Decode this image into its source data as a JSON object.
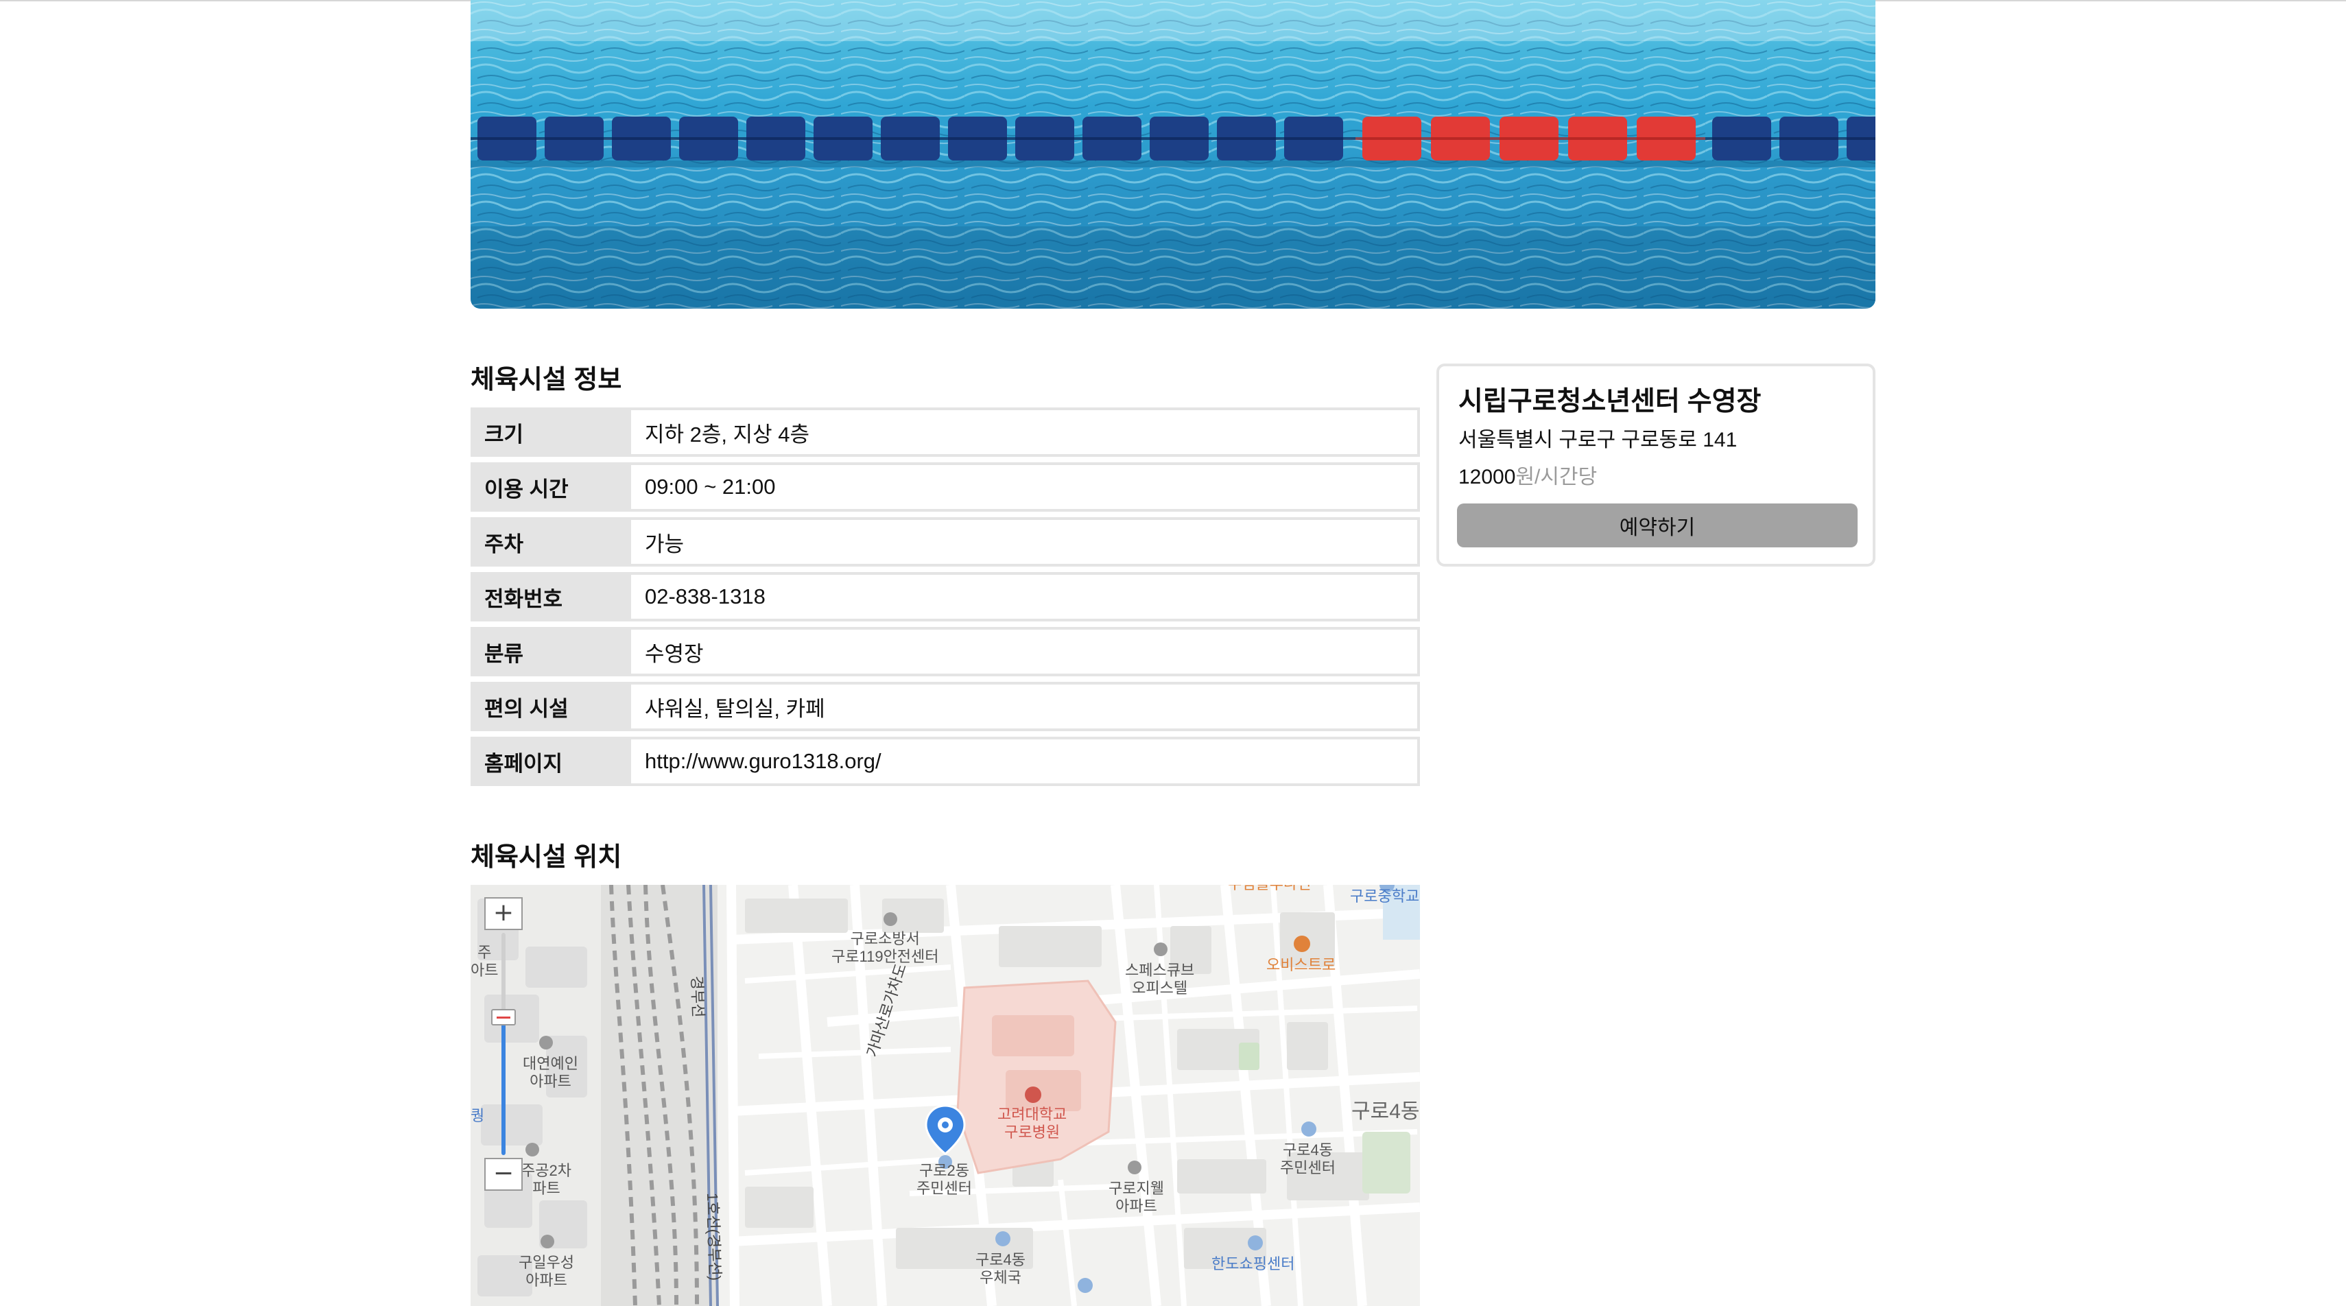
{
  "info_section": {
    "title": "체육시설 정보",
    "rows": [
      {
        "key": "크기",
        "value": "지하 2층, 지상 4층"
      },
      {
        "key": "이용 시간",
        "value": "09:00 ~ 21:00"
      },
      {
        "key": "주차",
        "value": "가능"
      },
      {
        "key": "전화번호",
        "value": "02-838-1318"
      },
      {
        "key": "분류",
        "value": "수영장"
      },
      {
        "key": "편의 시설",
        "value": "샤워실, 탈의실, 카페"
      },
      {
        "key": "홈페이지",
        "value": "http://www.guro1318.org/"
      }
    ]
  },
  "location_section": {
    "title": "체육시설 위치"
  },
  "booking_card": {
    "name": "시립구로청소년센터 수영장",
    "address": "서울특별시 구로구 구로동로 141",
    "price": "12000",
    "price_unit": "원/시간당",
    "reserve_label": "예약하기"
  },
  "map": {
    "zoom_in_label": "+",
    "zoom_out_label": "−",
    "zoom_level_fraction": 0.62,
    "labels": {
      "fire_station": "구로소방서\n구로119안전센터",
      "spacecube": "스페스큐브\n오피스텔",
      "obis": "오비스트로",
      "guro_middle": "구로중학교",
      "top_cut": "우림블루나인",
      "daeyeon": "대연예인\n아파트",
      "jugong": "주공2차\n파트",
      "guil": "구일우성\n아파트",
      "hospital": "고려대학교\n구로병원",
      "guro2": "구로2동\n주민센터",
      "guro4_center": "구로4동\n주민센터",
      "guro4_district": "구로4동",
      "jiwell": "구로지웰\n아파트",
      "guro4_post": "구로4동\n우체국",
      "handoshop": "한도쇼핑센터",
      "gamasan_road": "가마산로가차도",
      "gyeongbu_line": "경부선",
      "subway_line1": "1호선(경부선)",
      "left_cut_1": "주\n아트",
      "left_cut_2": "퀑"
    }
  },
  "colors": {
    "label_bg": "#e4e4e4",
    "button_bg": "#a3a3a3",
    "price_unit": "#9a9a9a",
    "hospital_area": "#f6d9d3",
    "pin_blue": "#3b84e0"
  }
}
